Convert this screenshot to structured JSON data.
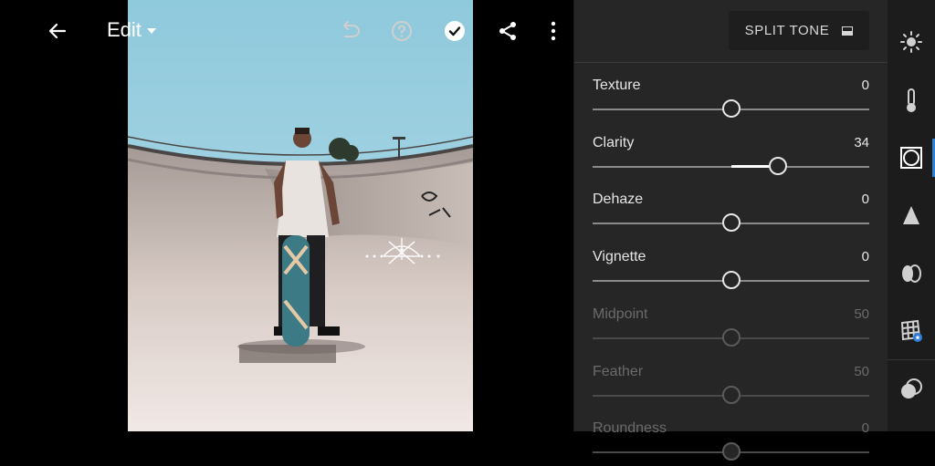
{
  "app": {
    "screen_title": "Edit"
  },
  "panel": {
    "mode_button": "SPLIT TONE",
    "sliders": [
      {
        "label": "Texture",
        "value": "0",
        "level": 0.5,
        "disabled": false
      },
      {
        "label": "Clarity",
        "value": "34",
        "level": 0.67,
        "disabled": false
      },
      {
        "label": "Dehaze",
        "value": "0",
        "level": 0.5,
        "disabled": false
      },
      {
        "label": "Vignette",
        "value": "0",
        "level": 0.5,
        "disabled": false
      },
      {
        "label": "Midpoint",
        "value": "50",
        "level": 0.5,
        "disabled": true
      },
      {
        "label": "Feather",
        "value": "50",
        "level": 0.5,
        "disabled": true
      },
      {
        "label": "Roundness",
        "value": "0",
        "level": 0.5,
        "disabled": true
      }
    ]
  },
  "icons": {
    "back": "back-arrow-icon",
    "undo": "undo-icon",
    "help": "help-icon",
    "done": "checkmark-icon",
    "share": "share-icon",
    "more": "more-vertical-icon",
    "light": "light-icon",
    "color": "color-temperature-icon",
    "effects": "effects-icon",
    "detail": "detail-icon",
    "optics": "optics-icon",
    "geometry": "geometry-icon",
    "presets": "presets-icon"
  },
  "colors": {
    "accent": "#2f7fd8",
    "panel_bg": "#262626",
    "rail_bg": "#1c1c1c"
  }
}
